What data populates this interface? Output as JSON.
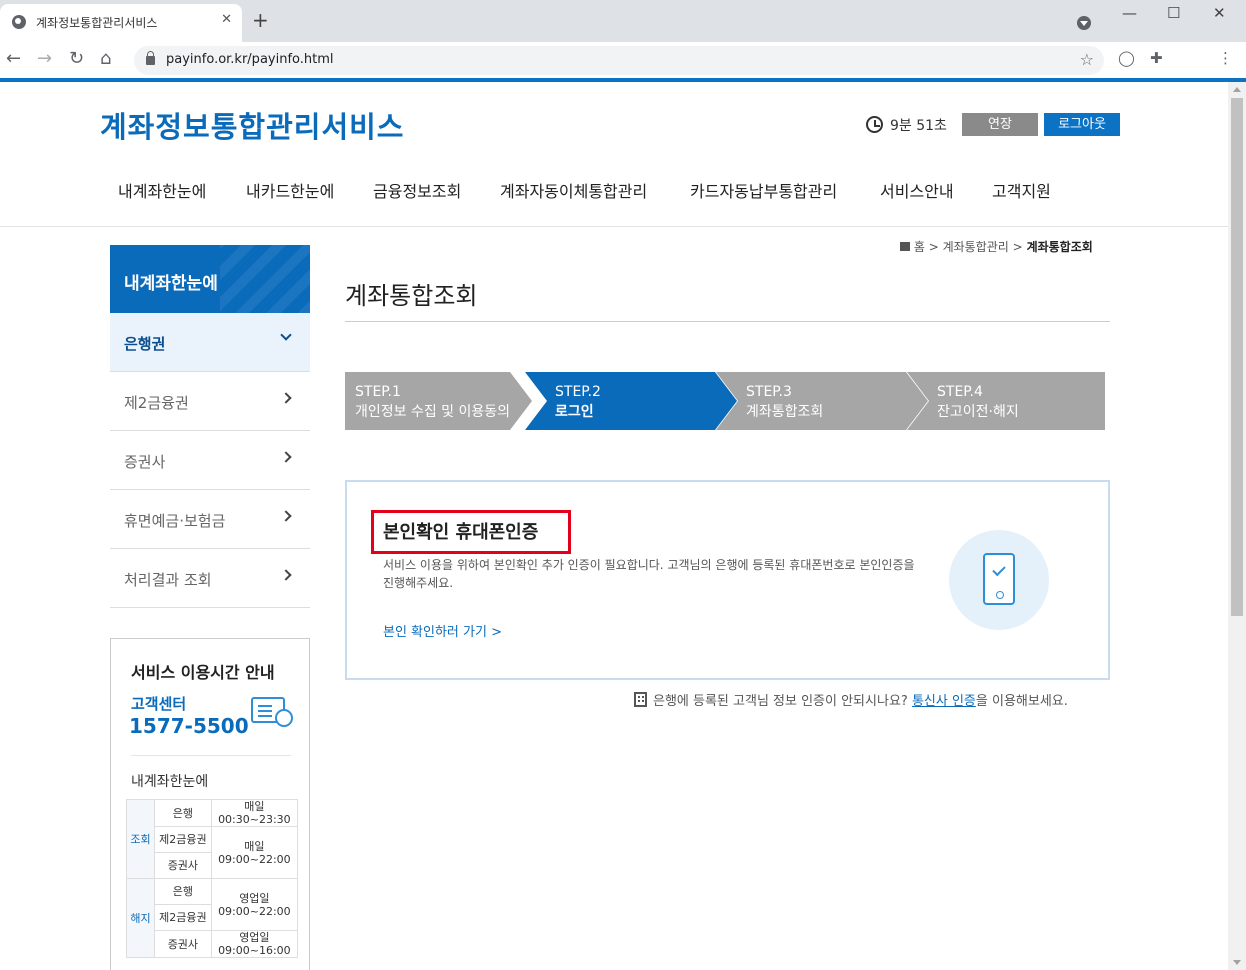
{
  "browser": {
    "tab_title": "계좌정보통합관리서비스",
    "tab_close": "✕",
    "new_tab": "+",
    "url": "payinfo.or.kr/payinfo.html",
    "back": "←",
    "forward": "→",
    "reload": "↻",
    "home": "⌂",
    "star": "☆",
    "menu": "⋮",
    "minimize": "—",
    "maximize": "☐",
    "close": "✕"
  },
  "header": {
    "logo": "계좌정보통합관리서비스",
    "timer": "9분 51초",
    "extend_label": "연장",
    "logout_label": "로그아웃"
  },
  "gnb": [
    "내계좌한눈에",
    "내카드한눈에",
    "금융정보조회",
    "계좌자동이체통합관리",
    "카드자동납부통합관리",
    "서비스안내",
    "고객지원"
  ],
  "sidebar": {
    "title": "내계좌한눈에",
    "items": [
      {
        "label": "은행권",
        "active": true
      },
      {
        "label": "제2금융권"
      },
      {
        "label": "증권사"
      },
      {
        "label": "휴면예금·보험금"
      },
      {
        "label": "처리결과 조회"
      }
    ],
    "info": {
      "title": "서비스 이용시간 안내",
      "cs_label": "고객센터",
      "cs_phone": "1577-5500",
      "section": "내계좌한눈에",
      "table": {
        "g1": "조회",
        "g2": "해지",
        "r1": "은행",
        "t1a": "매일",
        "t1b": "00:30~23:30",
        "r2": "제2금융권",
        "t2a": "매일",
        "t2b": "09:00~22:00",
        "r3": "증권사",
        "r4": "은행",
        "t4a": "영업일",
        "t4b": "09:00~22:00",
        "r5": "제2금융권",
        "r6": "증권사",
        "t6a": "영업일",
        "t6b": "09:00~16:00"
      }
    }
  },
  "breadcrumb": {
    "home": "홈",
    "sep": ">",
    "level1": "계좌통합관리",
    "current": "계좌통합조회"
  },
  "page_title": "계좌통합조회",
  "steps": [
    {
      "no": "STEP.1",
      "name": "개인정보 수집 및 이용동의"
    },
    {
      "no": "STEP.2",
      "name": "로그인"
    },
    {
      "no": "STEP.3",
      "name": "계좌통합조회"
    },
    {
      "no": "STEP.4",
      "name": "잔고이전·해지"
    }
  ],
  "auth": {
    "title": "본인확인 휴대폰인증",
    "desc": "서비스 이용을 위하여 본인확인 추가 인증이 필요합니다. 고객님의 은행에 등록된 휴대폰번호로 본인인증을 진행해주세요.",
    "link": "본인 확인하러 가기 >"
  },
  "notice": {
    "before": "은행에 등록된 고객님 정보 인증이 안되시나요?",
    "link": "통신사 인증",
    "after": "을 이용해보세요."
  },
  "colors": {
    "brand": "#0b6bbb",
    "step_inactive": "#a6a6a6",
    "highlight": "#e3001b"
  }
}
